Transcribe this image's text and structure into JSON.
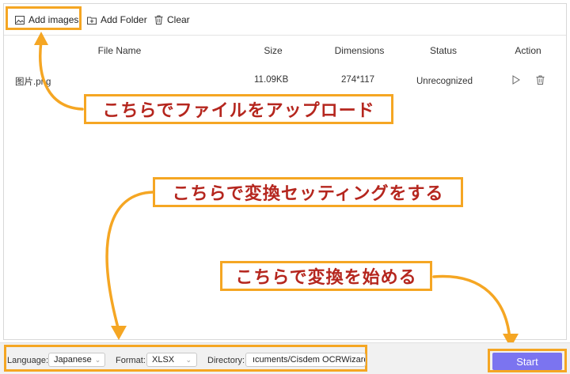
{
  "toolbar": {
    "add_images": "Add images",
    "add_folder": "Add Folder",
    "clear": "Clear"
  },
  "table": {
    "headers": [
      "File Name",
      "Size",
      "Dimensions",
      "Status",
      "Action"
    ],
    "rows": [
      {
        "file_name": "图片.png",
        "size": "11.09KB",
        "dimensions": "274*117",
        "status": "Unrecognized"
      }
    ]
  },
  "annotations": {
    "upload": "こちらでファイルをアップロード",
    "settings": "こちらで変換セッティングをする",
    "start": "こちらで変換を始める"
  },
  "settings": {
    "language_label": "Language:",
    "language_value": "Japanese",
    "format_label": "Format:",
    "format_value": "XLSX",
    "directory_label": "Directory:",
    "directory_value": "ıcuments/Cisdem OCRWizard"
  },
  "start_label": "Start",
  "colors": {
    "highlight": "#f5a623",
    "annotation_text": "#b5261e",
    "start_button": "#7b74f0"
  }
}
